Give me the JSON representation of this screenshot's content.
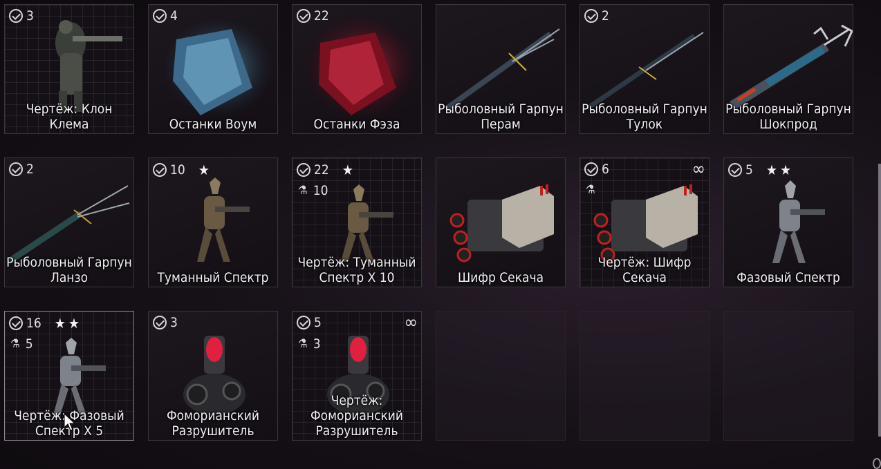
{
  "items": [
    {
      "count": "3",
      "stars": "",
      "craft": "",
      "infinite": false,
      "name": "Чертёж: Клон Клема",
      "icon": "clem-figure-icon"
    },
    {
      "count": "4",
      "stars": "",
      "craft": "",
      "infinite": false,
      "name": "Останки Воум",
      "icon": "blue-remains-icon"
    },
    {
      "count": "22",
      "stars": "",
      "craft": "",
      "infinite": false,
      "name": "Останки Фэза",
      "icon": "red-remains-icon"
    },
    {
      "count": "",
      "stars": "",
      "craft": "",
      "infinite": false,
      "name": "Рыболовный Гарпун Перам",
      "icon": "spear-peram-icon"
    },
    {
      "count": "2",
      "stars": "",
      "craft": "",
      "infinite": false,
      "name": "Рыболовный Гарпун Тулок",
      "icon": "spear-tulok-icon"
    },
    {
      "count": "",
      "stars": "",
      "craft": "",
      "infinite": false,
      "name": "Рыболовный Гарпун Шокпрод",
      "icon": "spear-shockprod-icon"
    },
    {
      "count": "2",
      "stars": "",
      "craft": "",
      "infinite": false,
      "name": "Рыболовный Гарпун Ланзо",
      "icon": "spear-lanzo-icon"
    },
    {
      "count": "10",
      "stars": "★",
      "craft": "",
      "infinite": false,
      "name": "Туманный Спектр",
      "icon": "specter-figure-icon"
    },
    {
      "count": "22",
      "stars": "★",
      "craft": "10",
      "infinite": false,
      "name": "Чертёж: Туманный Спектр X 10",
      "icon": "specter-figure-icon"
    },
    {
      "count": "",
      "stars": "",
      "craft": "",
      "infinite": false,
      "name": "Шифр Секача",
      "icon": "cipher-device-icon"
    },
    {
      "count": "6",
      "stars": "",
      "craft": " ",
      "infinite": true,
      "name": "Чертёж: Шифр Секача",
      "icon": "cipher-device-icon"
    },
    {
      "count": "5",
      "stars": "★★",
      "craft": "",
      "infinite": false,
      "name": "Фазовый Спектр",
      "icon": "specter-figure-icon"
    },
    {
      "count": "16",
      "stars": "★★",
      "craft": "5",
      "infinite": false,
      "name": "Чертёж: Фазовый Спектр X 5",
      "icon": "specter-figure-icon"
    },
    {
      "count": "3",
      "stars": "",
      "craft": "",
      "infinite": false,
      "name": "Фоморианский Разрушитель",
      "icon": "fomorian-disruptor-icon"
    },
    {
      "count": "5",
      "stars": "",
      "craft": "3",
      "infinite": true,
      "name": "Чертёж: Фоморианский Разрушитель",
      "icon": "fomorian-disruptor-icon"
    }
  ],
  "symbols": {
    "check": "owned-check-icon",
    "craft": "⚗",
    "infinite": "∞"
  }
}
